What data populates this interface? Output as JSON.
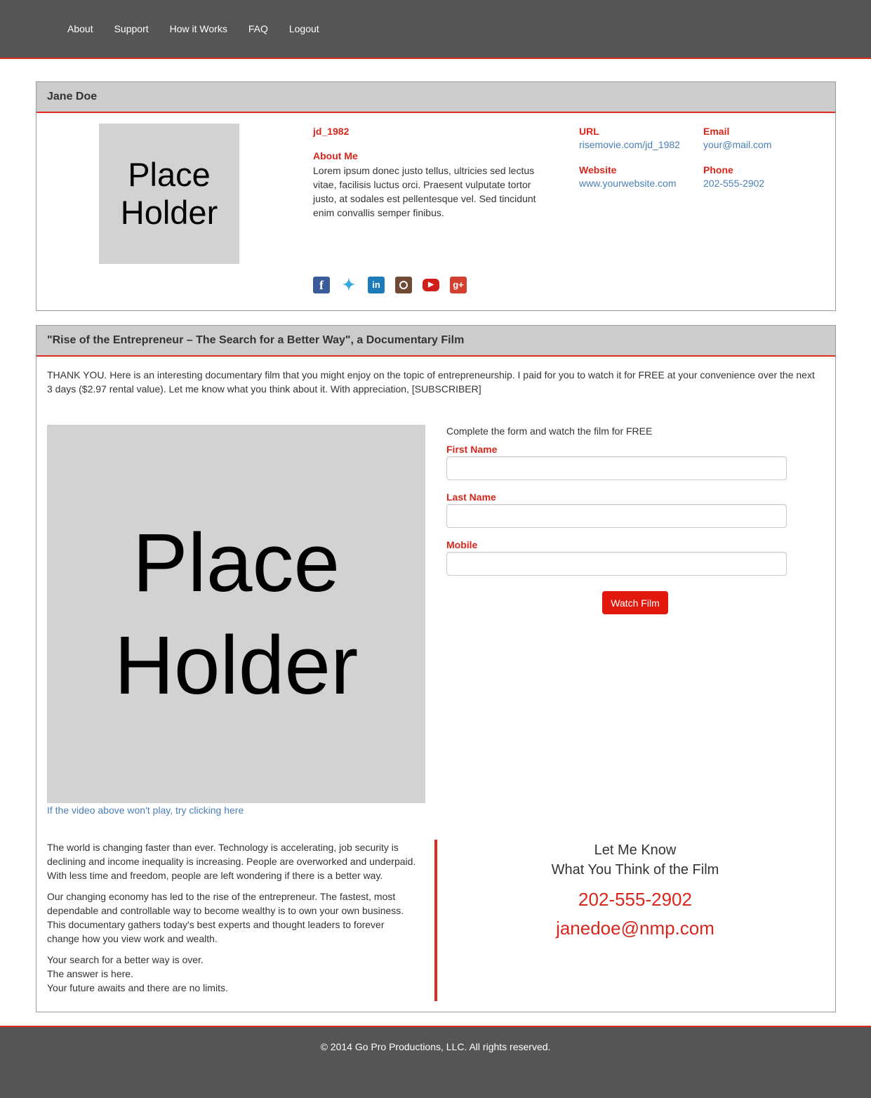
{
  "nav": {
    "items": [
      "About",
      "Support",
      "How it Works",
      "FAQ",
      "Logout"
    ]
  },
  "profile": {
    "name": "Jane Doe",
    "photo_placeholder": "Place Holder",
    "username": "jd_1982",
    "about_label": "About Me",
    "about_text": "Lorem ipsum donec justo tellus, ultricies sed lectus vitae, facilisis luctus orci. Praesent vulputate tortor justo, at sodales est pellentesque vel. Sed tincidunt enim convallis semper finibus.",
    "url_label": "URL",
    "url_value": "risemovie.com/jd_1982",
    "email_label": "Email",
    "email_value": "your@mail.com",
    "website_label": "Website",
    "website_value": "www.yourwebsite.com",
    "phone_label": "Phone",
    "phone_value": "202-555-2902",
    "socials": [
      "facebook-icon",
      "twitter-icon",
      "linkedin-icon",
      "instagram-icon",
      "youtube-icon",
      "google-plus-icon"
    ]
  },
  "film": {
    "title": "\"Rise of the Entrepreneur – The Search for a Better Way\", a Documentary Film",
    "intro": "THANK YOU. Here is an interesting documentary film that you might enjoy on the topic of entrepreneurship. I paid for you to watch it for FREE at your convenience over the next 3 days ($2.97 rental value). Let me know what you think about it. With appreciation, [SUBSCRIBER]",
    "video_placeholder": "Place Holder",
    "video_link": "If the video above won't play, try clicking here",
    "form": {
      "intro": "Complete the form and watch the film for FREE",
      "first_name_label": "First Name",
      "first_name_value": "",
      "last_name_label": "Last Name",
      "last_name_value": "",
      "mobile_label": "Mobile",
      "mobile_value": "",
      "submit_label": "Watch Film"
    },
    "story": {
      "p1": "The world is changing faster than ever. Technology is accelerating, job security is declining and income inequality is increasing. People are overworked and underpaid. With less time and freedom, people are left wondering if there is a better way.",
      "p2": "Our changing economy has led to the rise of the entrepreneur. The fastest, most dependable and controllable way to become wealthy is to own your own business. This documentary gathers today's best experts and thought leaders to forever change how you view work and wealth.",
      "line1": "Your search for a better way is over.",
      "line2": "The answer is here.",
      "line3": "Your future awaits and there are no limits."
    },
    "contact": {
      "heading1": "Let Me Know",
      "heading2": "What You Think of the Film",
      "phone": "202-555-2902",
      "email": "janedoe@nmp.com"
    }
  },
  "footer": {
    "text": "© 2014 Go Pro Productions, LLC. All rights reserved."
  },
  "colors": {
    "accent": "#e02b20",
    "nav_bg": "#555555",
    "panel_head_bg": "#cccccc",
    "link": "#4a7fb8"
  }
}
